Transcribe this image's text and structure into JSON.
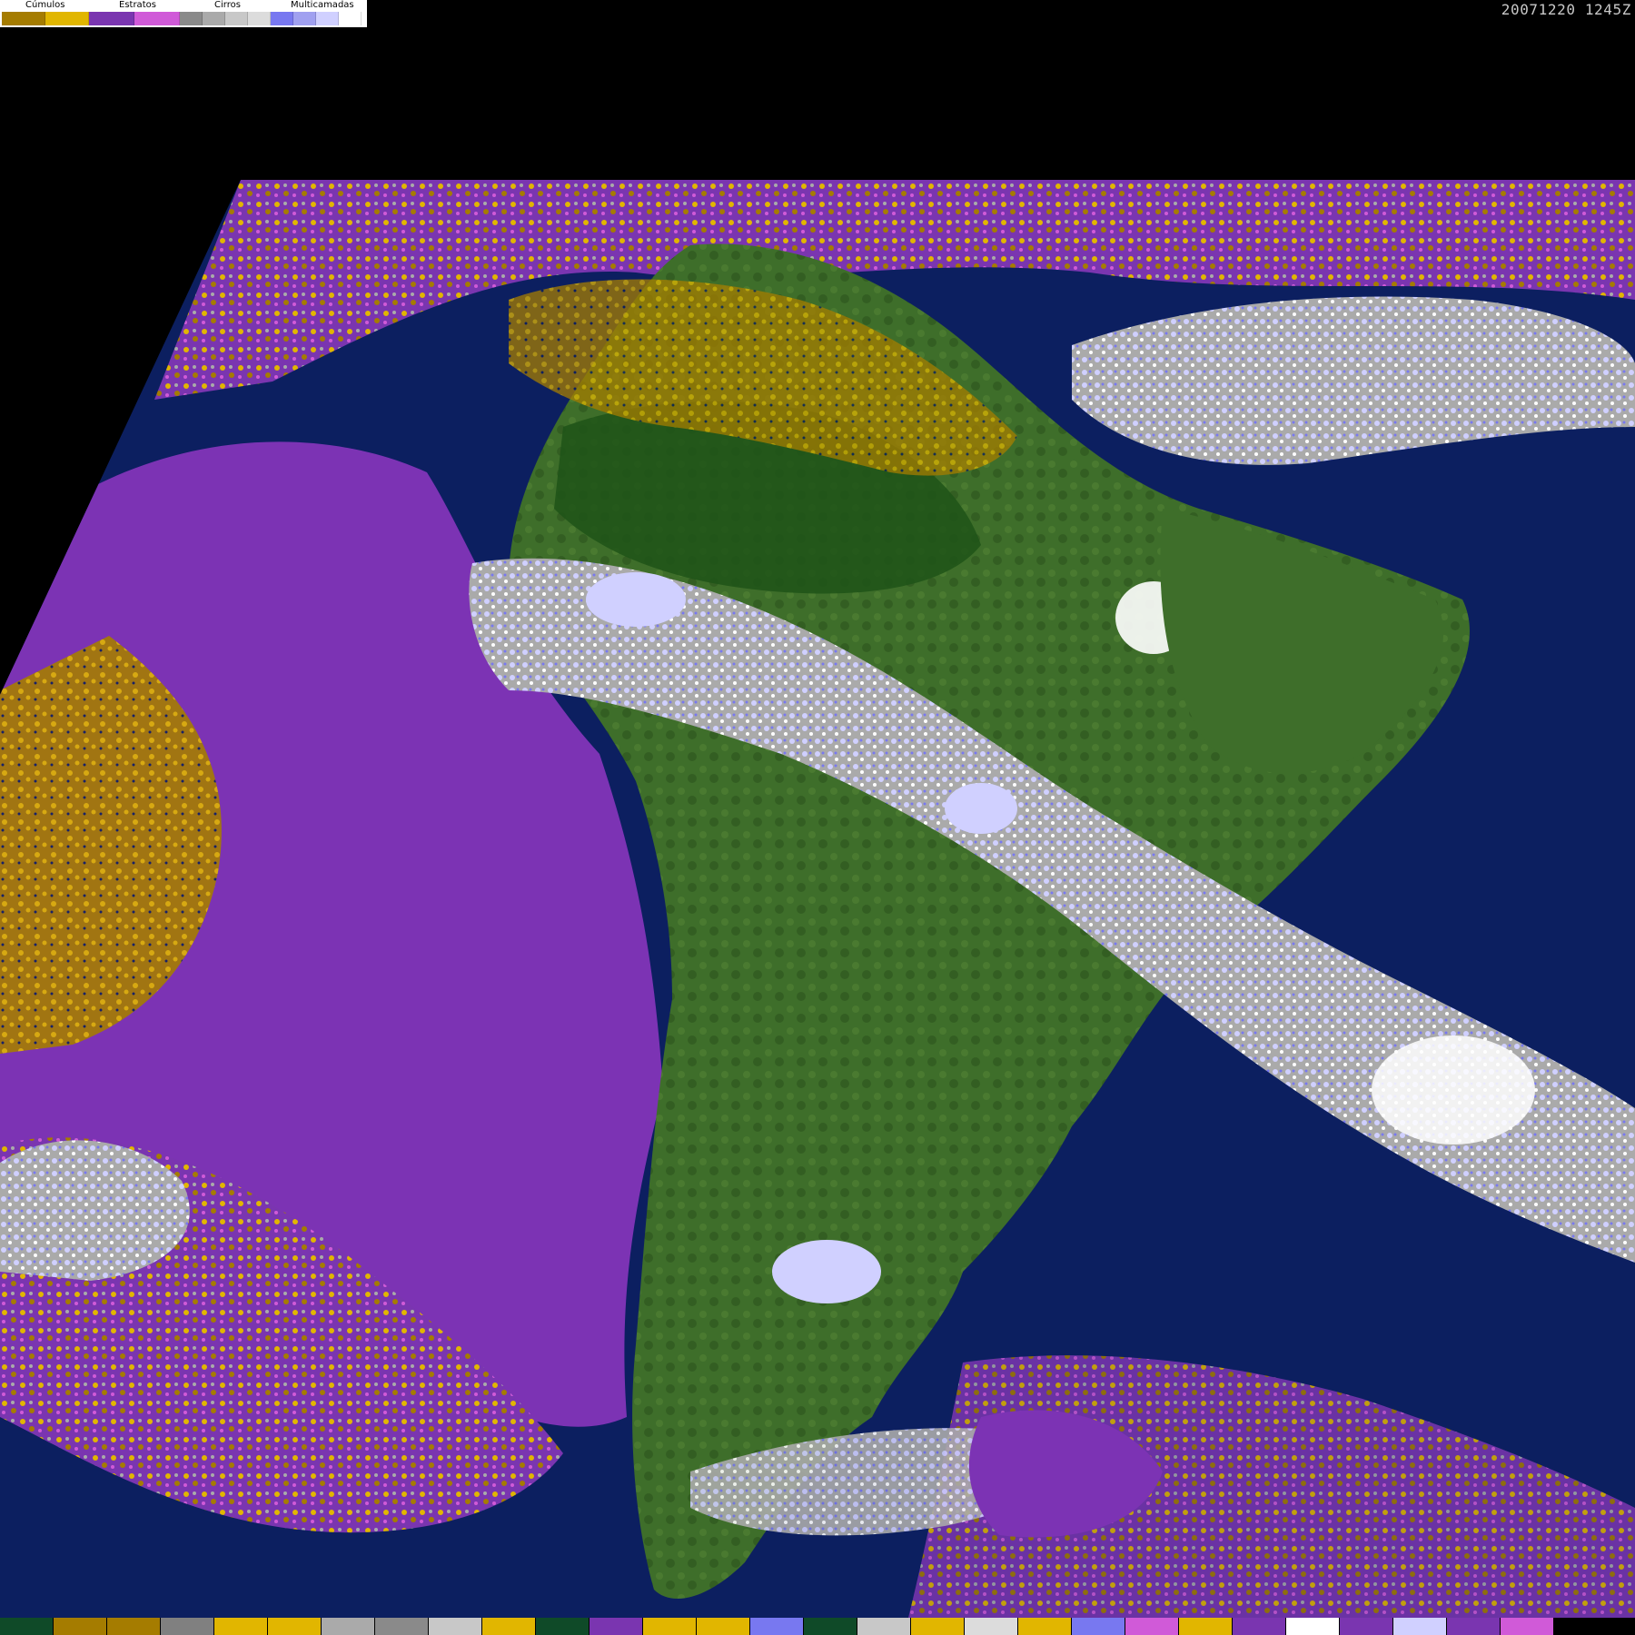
{
  "timestamp": "20071220 1245Z",
  "legend": {
    "categories": [
      {
        "label": "Cúmulos",
        "swatches": [
          "#a57c00",
          "#e1b600"
        ]
      },
      {
        "label": "Estratos",
        "swatches": [
          "#7a35b0",
          "#d05ad8"
        ]
      },
      {
        "label": "Cirros",
        "swatches": [
          "#8a8a8a",
          "#aaaaaa",
          "#c8c8c8",
          "#dcdcdc"
        ]
      },
      {
        "label": "Multicamadas",
        "swatches": [
          "#7878f0",
          "#a0a0f0",
          "#d0d0ff",
          "#ffffff"
        ]
      }
    ]
  },
  "colors": {
    "ocean": "#0c1f60",
    "land": "#3e6e2a",
    "land_dark": "#1e5418",
    "stratus": "#7c33b4",
    "cumulus_dark": "#a57c00",
    "cumulus_light": "#e1b600",
    "cirrus": "#b5b5b5",
    "multilayer": "#7f7ff0",
    "multilayer_light": "#d0d0ff",
    "background": "#000000"
  },
  "bottom_strip": [
    "#0f4a28",
    "#a57c00",
    "#a57c00",
    "#808080",
    "#e1b600",
    "#e1b600",
    "#aaaaaa",
    "#8a8a8a",
    "#c8c8c8",
    "#e1b600",
    "#0f4a28",
    "#7a35b0",
    "#e1b600",
    "#e1b600",
    "#7878f0",
    "#0f4a28",
    "#c8c8c8",
    "#e1b600",
    "#dcdcdc",
    "#e1b600",
    "#7878f0",
    "#d05ad8",
    "#e1b600",
    "#7a35b0",
    "#ffffff",
    "#7a35b0",
    "#d0d0ff",
    "#7a35b0",
    "#d05ad8",
    "#000000",
    "#000000"
  ]
}
